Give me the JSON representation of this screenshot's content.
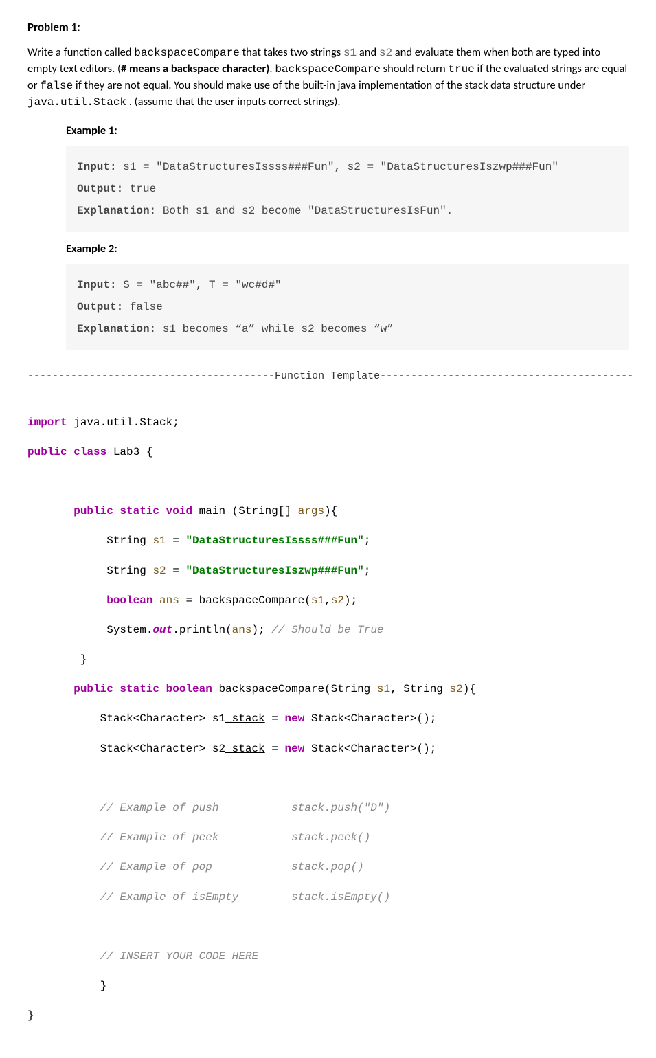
{
  "problem": {
    "title": "Problem 1:",
    "intro_p1_a": "Write a function called ",
    "intro_fn": "backspaceCompare",
    "intro_p1_b": " that takes two strings ",
    "param_s1": "s1",
    "intro_and": " and ",
    "param_s2": "s2",
    "intro_p1_c": " and evaluate them when both are typed into empty text editors. (",
    "bold_hash": "# means a backspace character)",
    "intro_p1_d": ". ",
    "intro_fn2": "backspaceCompare",
    "intro_p1_e": " should return ",
    "mono_true": "true",
    "intro_p1_f": " if the evaluated strings are equal or ",
    "mono_false": "false",
    "intro_p1_g": " if they are not equal.  You should make use of the built-in java implementation of the stack data structure under ",
    "mono_jus": "java.util.Stack",
    "intro_p1_h": " . (assume that the user inputs correct strings)."
  },
  "ex1": {
    "label": "Example 1:",
    "input_lbl": "Input:",
    "input": " s1 = \"DataStructuresIssss###Fun\", s2 = \"DataStructuresIszwp###Fun\"",
    "output_lbl": "Output:",
    "output": " true",
    "expl_lbl": "Explanation",
    "expl": ": Both s1 and s2 become \"DataStructuresIsFun\"."
  },
  "ex2": {
    "label": "Example 2:",
    "input_lbl": "Input:",
    "input": " S = \"abc##\", T = \"wc#d#\"",
    "output_lbl": "Output:",
    "output": " false",
    "expl_lbl": "Explanation",
    "expl": ": s1 becomes “a” while s2 becomes “w”"
  },
  "sep": "----------------------------------------Function Template-----------------------------------------",
  "code": {
    "l01a": "import",
    "l01b": " java.util.Stack;",
    "l02a": "public class",
    "l02b": " Lab3 {",
    "blank1": "",
    "l04a": "       public static void",
    "l04b": " main (String[] ",
    "l04c": "args",
    "l04d": "){",
    "l05a": "            String ",
    "l05b": "s1",
    "l05c": " = ",
    "l05d": "\"DataStructuresIssss###Fun\"",
    "l05e": ";",
    "l06a": "            String ",
    "l06b": "s2",
    "l06c": " = ",
    "l06d": "\"DataStructuresIszwp###Fun\"",
    "l06e": ";",
    "l07a": "            boolean ",
    "l07b": "ans",
    "l07c": " = backspaceCompare(",
    "l07d": "s1",
    "l07e": ",",
    "l07f": "s2",
    "l07g": ");",
    "l08a": "            System.",
    "l08b": "out",
    "l08c": ".println(",
    "l08d": "ans",
    "l08e": "); ",
    "l08f": "// Should be True",
    "l09": "        }",
    "l10a": "       public static boolean",
    "l10b": " backspaceCompare(String ",
    "l10c": "s1",
    "l10d": ", String ",
    "l10e": "s2",
    "l10f": "){",
    "l11a": "           Stack<Character> s1",
    "l11b": "_stack",
    "l11c": " = ",
    "l11d": "new",
    "l11e": " Stack<Character>();",
    "l12a": "           Stack<Character> s2",
    "l12b": "_stack",
    "l12c": " = ",
    "l12d": "new",
    "l12e": " Stack<Character>();",
    "blank2": "",
    "l14": "           // Example of push           stack.push(\"D\")",
    "l15": "           // Example of peek           stack.peek()",
    "l16": "           // Example of pop            stack.pop()",
    "l17": "           // Example of isEmpty        stack.isEmpty()",
    "blank3": "",
    "l19": "           // INSERT YOUR CODE HERE",
    "l20": "           }",
    "l21": "}"
  }
}
